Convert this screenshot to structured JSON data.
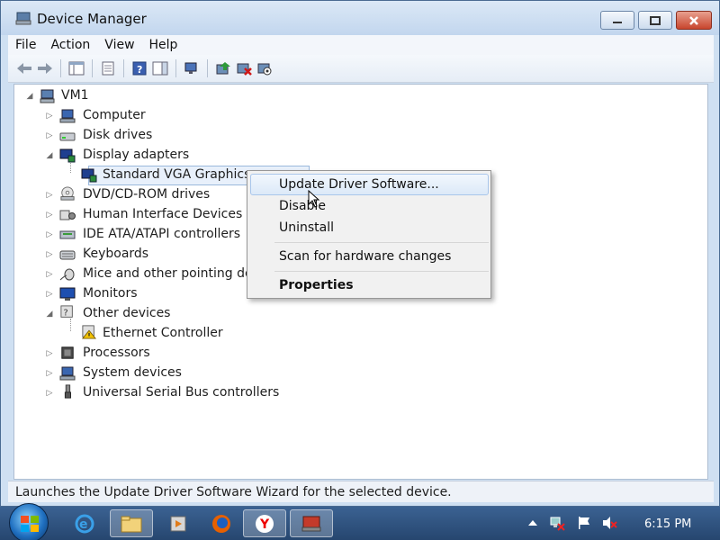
{
  "window": {
    "title": "Device Manager"
  },
  "menubar": {
    "items": [
      "File",
      "Action",
      "View",
      "Help"
    ]
  },
  "tree": {
    "root": "VM1",
    "items": [
      {
        "label": "Computer",
        "expanded": false
      },
      {
        "label": "Disk drives",
        "expanded": false
      },
      {
        "label": "Display adapters",
        "expanded": true,
        "children": [
          "Standard VGA Graphics"
        ]
      },
      {
        "label": "DVD/CD-ROM drives",
        "expanded": false
      },
      {
        "label": "Human Interface Devices",
        "expanded": false
      },
      {
        "label": "IDE ATA/ATAPI controllers",
        "expanded": false
      },
      {
        "label": "Keyboards",
        "expanded": false
      },
      {
        "label": "Mice and other pointing de",
        "expanded": false
      },
      {
        "label": "Monitors",
        "expanded": false
      },
      {
        "label": "Other devices",
        "expanded": true,
        "children": [
          "Ethernet Controller"
        ]
      },
      {
        "label": "Processors",
        "expanded": false
      },
      {
        "label": "System devices",
        "expanded": false
      },
      {
        "label": "Universal Serial Bus controllers",
        "expanded": false
      }
    ]
  },
  "context_menu": {
    "items": [
      "Update Driver Software...",
      "Disable",
      "Uninstall",
      "Scan for hardware changes",
      "Properties"
    ],
    "highlighted": "Update Driver Software..."
  },
  "statusbar": {
    "text": "Launches the Update Driver Software Wizard for the selected device."
  },
  "taskbar": {
    "clock": "6:15 PM"
  },
  "colors": {
    "accent": "#26466f",
    "selection": "#dce9f8"
  }
}
